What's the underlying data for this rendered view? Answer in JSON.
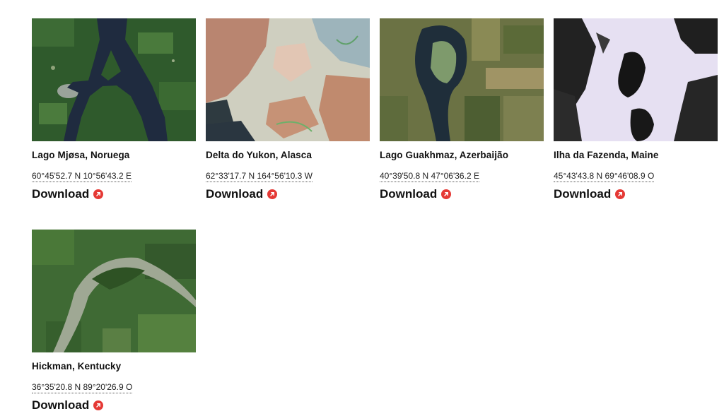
{
  "colors": {
    "accent": "#e53935",
    "text": "#111111"
  },
  "download_label": "Download",
  "download_icon": "arrow-up-right-circle-icon",
  "cards": [
    {
      "title": "Lago Mjøsa, Noruega",
      "coords": "60°45'52.7 N 10°56'43.2 E",
      "image": "lake-mjosa-satellite-image"
    },
    {
      "title": "Delta do Yukon, Alasca",
      "coords": "62°33'17.7 N 164°56'10.3 W",
      "image": "yukon-delta-satellite-image"
    },
    {
      "title": "Lago Guakhmaz, Azerbaijão",
      "coords": "40°39'50.8 N 47°06'36.2 E",
      "image": "lake-guakhmaz-satellite-image"
    },
    {
      "title": "Ilha da Fazenda, Maine",
      "coords": "45°43'43.8 N 69°46'08.9 O",
      "image": "farm-island-satellite-image"
    },
    {
      "title": "Hickman, Kentucky",
      "coords": "36°35'20.8 N 89°20'26.9 O",
      "image": "hickman-satellite-image"
    }
  ]
}
